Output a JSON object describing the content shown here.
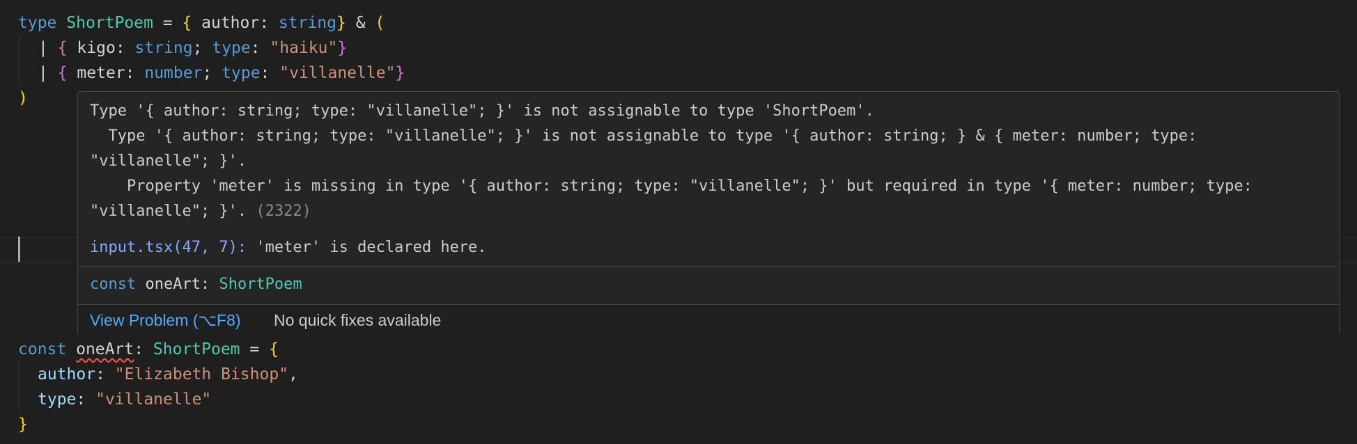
{
  "editor": {
    "type_decl": {
      "kw": "type",
      "name": "ShortPoem",
      "eq": " = ",
      "open_brace": "{",
      "author_key": " author",
      "colon": ": ",
      "string_type": "string",
      "close_brace": "}",
      "amp": " & ",
      "open_paren": "("
    },
    "union1": {
      "bar": "| ",
      "ob": "{",
      "key": " kigo",
      "colon": ": ",
      "type": "string",
      "semi": "; ",
      "tkey": "type",
      "colon2": ": ",
      "val": "\"haiku\"",
      "cb": "}"
    },
    "union2": {
      "bar": "| ",
      "ob": "{",
      "key": " meter",
      "colon": ": ",
      "type": "number",
      "semi": "; ",
      "tkey": "type",
      "colon2": ": ",
      "val": "\"villanelle\"",
      "cb": "}"
    },
    "close_paren": ")",
    "const_decl": {
      "kw": "const",
      "name": "oneArt",
      "colon": ": ",
      "type": "ShortPoem",
      "eq": " = ",
      "ob": "{"
    },
    "author_line": {
      "key": "author",
      "colon": ": ",
      "val": "\"Elizabeth Bishop\"",
      "comma": ","
    },
    "type_line": {
      "key": "type",
      "colon": ": ",
      "val": "\"villanelle\""
    },
    "close_brace": "}"
  },
  "hover": {
    "error_line1": "Type '{ author: string; type: \"villanelle\"; }' is not assignable to type 'ShortPoem'.",
    "error_line2": "  Type '{ author: string; type: \"villanelle\"; }' is not assignable to type '{ author: string; } & { meter: number; type:",
    "error_line3": "\"villanelle\"; }'.",
    "error_line4": "    Property 'meter' is missing in type '{ author: string; type: \"villanelle\"; }' but required in type '{ meter: number; type:",
    "error_line5": "\"villanelle\"; }'. ",
    "error_code": "(2322)",
    "related_ref": "input.tsx(47, 7):",
    "related_msg": " 'meter' is declared here.",
    "sig_kw": "const",
    "sig_name": " oneArt",
    "sig_colon": ": ",
    "sig_type": "ShortPoem",
    "view_problem": "View Problem (⌥F8)",
    "no_fixes": "No quick fixes available"
  },
  "colors": {
    "background": "#1f1f1f",
    "keyword": "#569cd6",
    "type": "#4ec9b0",
    "string": "#ce9178",
    "property": "#9cdcfe",
    "error_squiggle": "#f14c4c",
    "link": "#4daafc"
  }
}
